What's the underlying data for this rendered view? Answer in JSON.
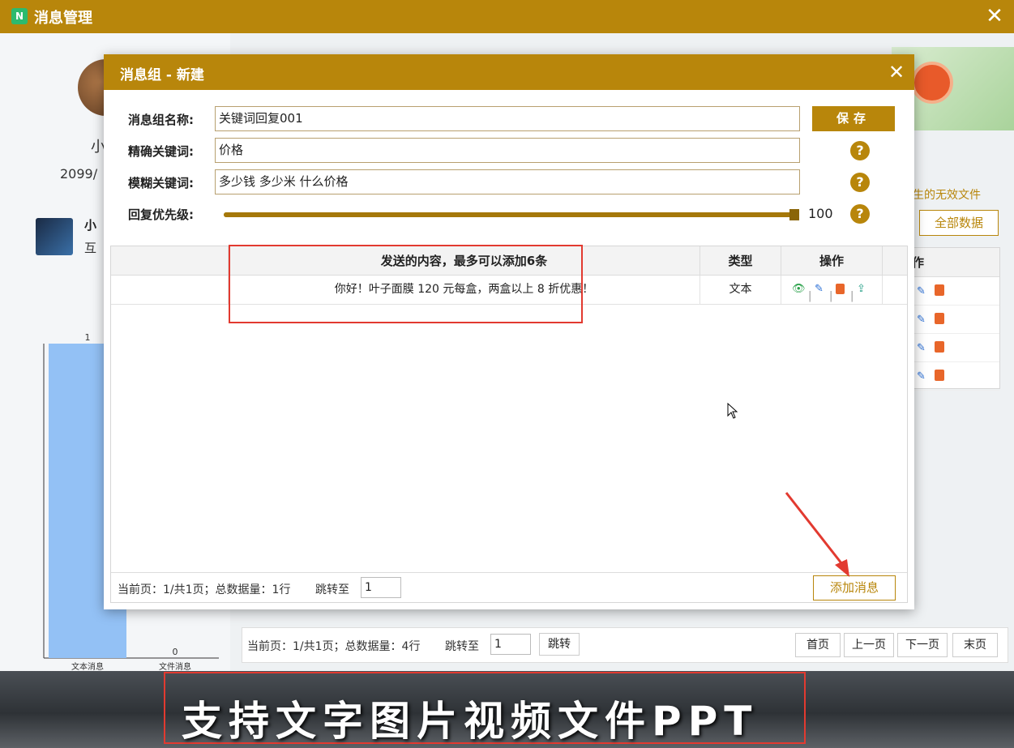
{
  "outer_window": {
    "title": "消息管理",
    "close_glyph": "✕"
  },
  "profile": {
    "name": "小",
    "date": "2099/",
    "account_name": "小",
    "account_sub": "互"
  },
  "chart_data": {
    "type": "bar",
    "categories": [
      "文本消息",
      "文件消息"
    ],
    "values": [
      1,
      0
    ],
    "data_labels": [
      "1",
      "0"
    ],
    "title": "",
    "xlabel": "",
    "ylabel": "",
    "ylim": [
      0,
      1
    ],
    "grid": false,
    "colors": [
      "#93c1f5"
    ]
  },
  "background": {
    "link_text": "生的无效文件",
    "all_data_button": "全部数据",
    "table_header": "作",
    "page_info": "当前页：1/共1页；总数据量：4行",
    "jump_label": "跳转至",
    "jump_value": "1",
    "jump_button": "跳转",
    "pager": [
      "首页",
      "上一页",
      "下一页",
      "末页"
    ]
  },
  "dialog": {
    "title": "消息组 - 新建",
    "close_glyph": "✕",
    "fields": {
      "group_name_label": "消息组名称:",
      "group_name_value": "关键词回复001",
      "exact_keyword_label": "精确关键词:",
      "exact_keyword_value": "价格",
      "fuzzy_keyword_label": "模糊关键词:",
      "fuzzy_keyword_value": "多少钱 多少米 什么价格",
      "priority_label": "回复优先级:",
      "priority_value": "100",
      "priority_fraction": 1.0
    },
    "save_button": "保存",
    "help_glyph": "?",
    "table": {
      "headers": {
        "content": "发送的内容，最多可以添加6条",
        "type": "类型",
        "ops": "操作"
      },
      "rows": [
        {
          "content": "你好！叶子面膜 120 元每盒，两盒以上 8 折优惠！",
          "type": "文本"
        }
      ],
      "page_info": "当前页：1/共1页；总数据量：1行",
      "jump_label": "跳转至",
      "jump_value": "1",
      "add_button": "添加消息"
    }
  },
  "caption": "支持文字图片视频文件PPT",
  "colors": {
    "accent": "#b8860b",
    "annotation_red": "#e23a30",
    "bar": "#93c1f5"
  }
}
